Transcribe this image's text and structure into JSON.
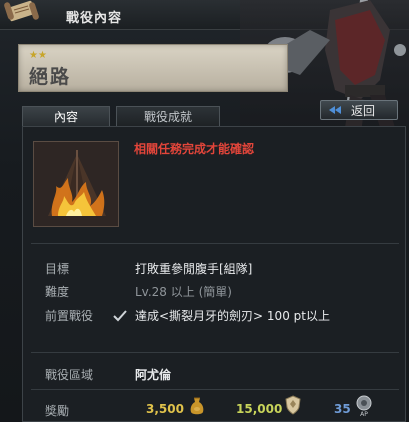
{
  "window": {
    "title": "戰役內容"
  },
  "campaign": {
    "stars": "★★",
    "name": "絕路"
  },
  "tabs": [
    {
      "label": "內容",
      "active": true
    },
    {
      "label": "戰役成就",
      "active": false
    }
  ],
  "back_button": {
    "label": "返回"
  },
  "notice": "相關任務完成才能確認",
  "details": {
    "objective_label": "目標",
    "objective_value": "打敗重參閒腹手[組隊]",
    "difficulty_label": "難度",
    "difficulty_value": "Lv.28 以上 (簡單)",
    "prerequisite_label": "前置戰役",
    "prerequisite_value": "達成<撕裂月牙的劍刃> 100 pt以上",
    "region_label": "戰役區域",
    "region_value": "阿尤倫",
    "reward_label": "獎勵",
    "reward_gold": "3,500",
    "reward_contribution": "15,000",
    "reward_ap": "35"
  },
  "colors": {
    "notice": "#e2453a",
    "gold": "#e0c24b",
    "contribution": "#c8d45a",
    "ap": "#6f9bd6"
  }
}
